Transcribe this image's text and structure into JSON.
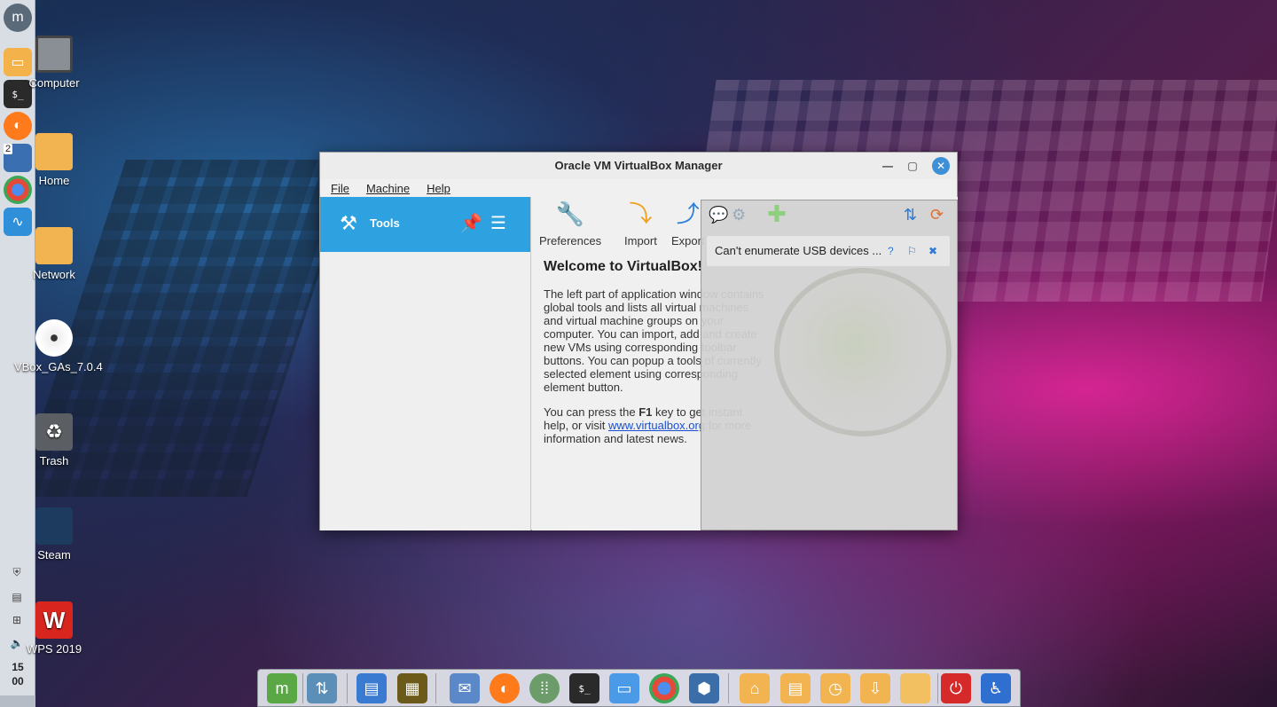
{
  "desktop": {
    "icons": [
      {
        "label": "Computer",
        "icon": "computer-icon"
      },
      {
        "label": "Home",
        "icon": "home-folder-icon"
      },
      {
        "label": "Network",
        "icon": "network-folder-icon"
      },
      {
        "label": "VBox_GAs_7.0.4",
        "icon": "disc-icon"
      },
      {
        "label": "Trash",
        "icon": "trash-icon"
      },
      {
        "label": "Steam",
        "icon": "steam-icon"
      },
      {
        "label": "WPS 2019",
        "icon": "wps-icon"
      }
    ]
  },
  "left_panel": {
    "launchers": [
      {
        "name": "mint-menu-icon"
      },
      {
        "name": "files-icon"
      },
      {
        "name": "terminal-icon",
        "glyph": "$_"
      },
      {
        "name": "firefox-icon"
      },
      {
        "name": "workspace-icon",
        "badge": "2"
      },
      {
        "name": "chrome-icon"
      },
      {
        "name": "system-monitor-icon"
      }
    ],
    "clock": {
      "hour": "15",
      "minute": "00"
    }
  },
  "window": {
    "title": "Oracle VM VirtualBox Manager",
    "menu": [
      "File",
      "Machine",
      "Help"
    ],
    "tools_label": "Tools",
    "toolbar": [
      {
        "label": "Preferences",
        "icon": "preferences-icon"
      },
      {
        "label": "Import",
        "icon": "import-icon"
      },
      {
        "label": "Export",
        "icon": "export-icon"
      }
    ],
    "welcome": {
      "heading": "Welcome to VirtualBox!",
      "para1": "The left part of application window contains global tools and lists all virtual machines and virtual machine groups on your computer. You can import, add and create new VMs using corresponding toolbar buttons. You can popup a tools of currently selected element using corresponding element button.",
      "para2_before": "You can press the ",
      "para2_key": "F1",
      "para2_mid": " key to get instant help, or visit ",
      "para2_link": "www.virtualbox.org",
      "para2_after": " for more information and latest news."
    },
    "notification": {
      "message": "Can't enumerate USB devices ..."
    }
  },
  "dock": {
    "items": [
      "mint-menu-icon",
      "show-desktop-icon",
      "text-editor-icon",
      "image-viewer-icon",
      "mail-icon",
      "firefox-icon",
      "app-grid-icon",
      "terminal-icon",
      "chat-icon",
      "chrome-icon",
      "virtualbox-icon",
      "home-folder-icon",
      "documents-folder-icon",
      "history-folder-icon",
      "downloads-folder-icon",
      "folder-icon",
      "power-icon",
      "accessibility-icon"
    ]
  }
}
